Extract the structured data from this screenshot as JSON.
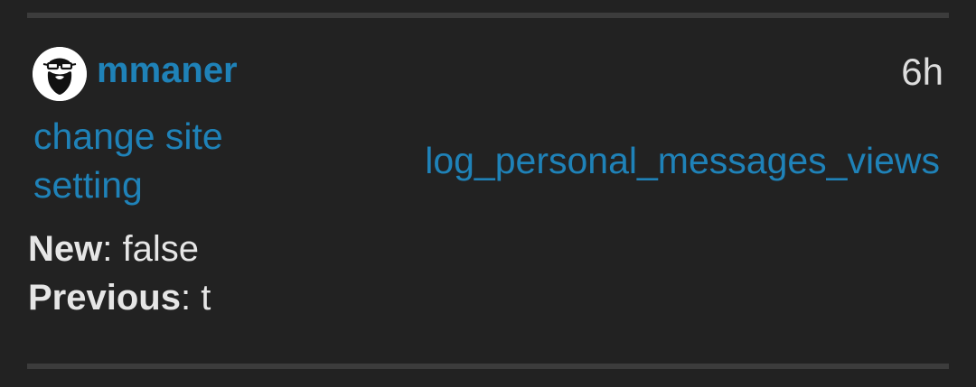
{
  "log_entry": {
    "user": {
      "username": "mmaner",
      "avatar": "bearded-man-with-glasses-avatar"
    },
    "age": "6h",
    "action": "change site setting",
    "subject": "log_personal_messages_views",
    "details": {
      "new_label": "New",
      "new_value": "false",
      "previous_label": "Previous",
      "previous_value": "t",
      "separator": ": "
    }
  },
  "colors": {
    "background": "#222222",
    "link": "#1f82b8",
    "text": "#e6e6e6",
    "muted": "#dddddd",
    "divider": "#3c3c3c"
  }
}
